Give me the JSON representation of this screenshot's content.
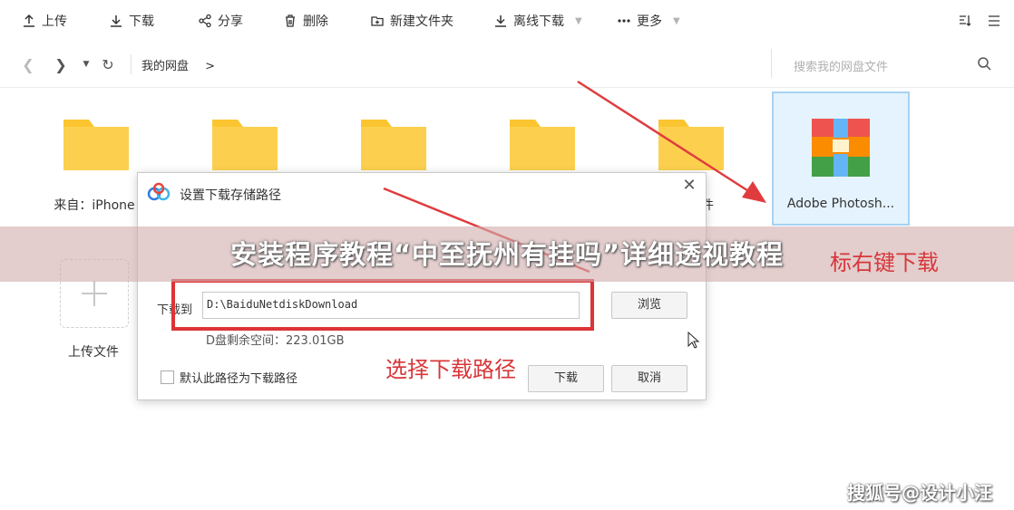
{
  "toolbar": {
    "upload": "上传",
    "download": "下载",
    "share": "分享",
    "delete": "删除",
    "new_folder": "新建文件夹",
    "offline_download": "离线下载",
    "more": "更多"
  },
  "nav": {
    "breadcrumb": "我的网盘",
    "breadcrumb_sep": ">",
    "search_placeholder": "搜索我的网盘文件"
  },
  "files": [
    {
      "name": "来自：iPhone"
    },
    {
      "name": ""
    },
    {
      "name": ""
    },
    {
      "name": ""
    },
    {
      "name": "件"
    },
    {
      "name": "Adobe Photosh..."
    }
  ],
  "upload_tile": {
    "label": "上传文件"
  },
  "overlay": {
    "title": "安装程序教程“中至抚州有挂吗”详细透视教程",
    "hint": "标右键下载"
  },
  "dialog": {
    "title": "设置下载存储路径",
    "path_label": "下载到",
    "path_value": "D:\\BaiduNetdiskDownload",
    "browse_button": "浏览",
    "space_info": "D盘剩余空间：223.01GB",
    "default_checkbox": "默认此路径为下载路径",
    "download_button": "下载",
    "cancel_button": "取消",
    "annotation": "选择下载路径"
  },
  "watermark": "搜狐号@设计小汪",
  "colors": {
    "accent_red": "#dd3437",
    "folder": "#fbc531",
    "selected_bg": "#e4f3fd"
  }
}
